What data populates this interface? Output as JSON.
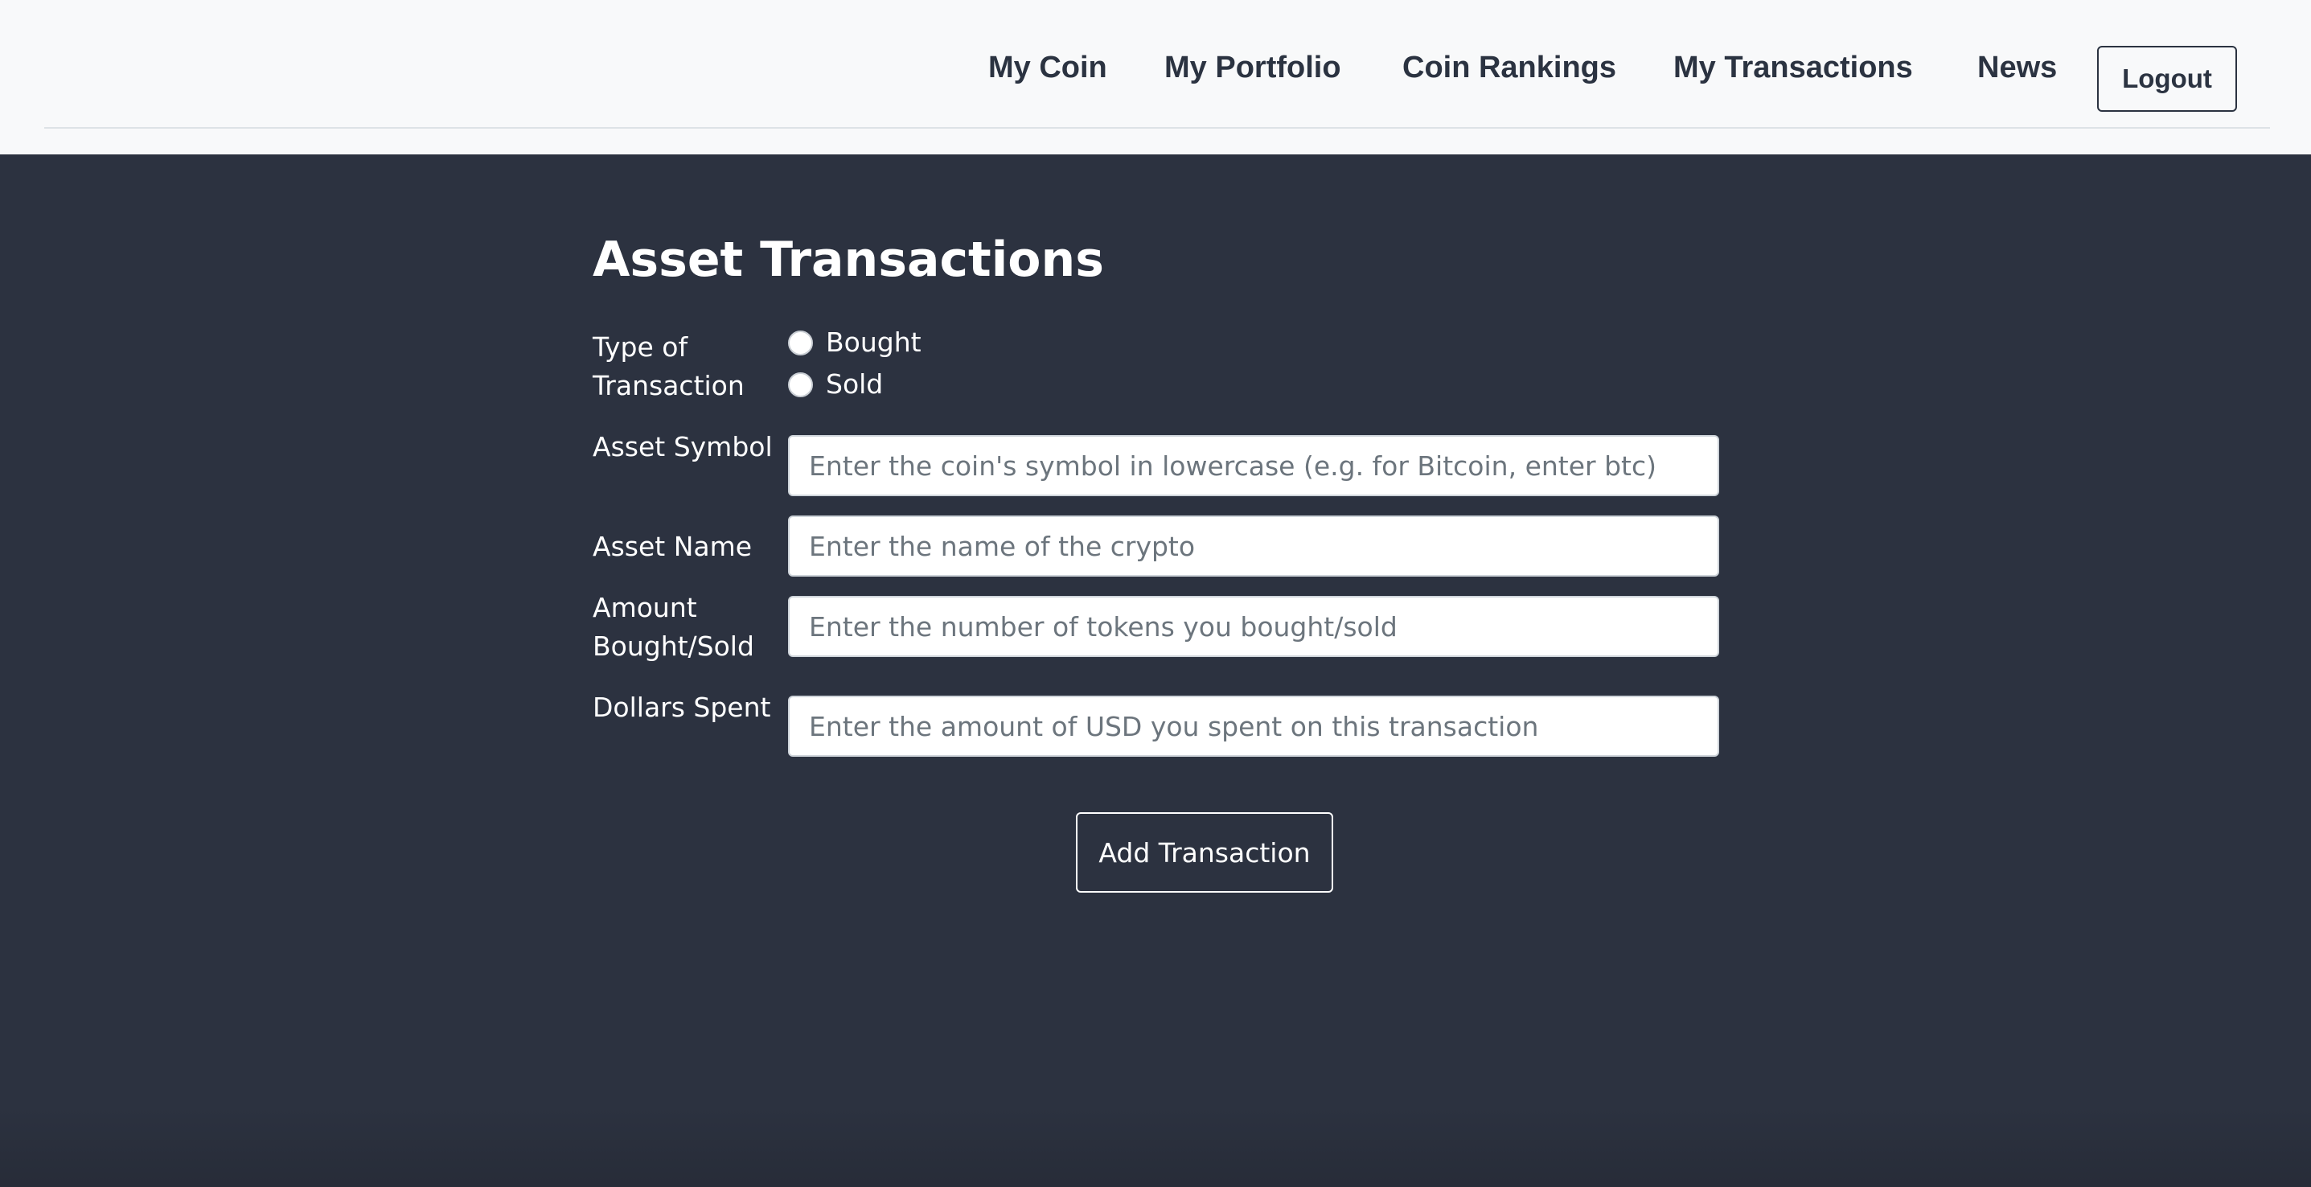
{
  "nav": {
    "links": [
      "My Coin",
      "My Portfolio",
      "Coin Rankings",
      "My Transactions",
      "News"
    ],
    "logout_label": "Logout"
  },
  "form": {
    "title": "Asset Transactions",
    "type_label": "Type of Transaction",
    "type_options": [
      "Bought",
      "Sold"
    ],
    "symbol_label": "Asset Symbol",
    "symbol_placeholder": "Enter the coin's symbol in lowercase (e.g. for Bitcoin, enter btc)",
    "symbol_value": "",
    "name_label": "Asset Name",
    "name_placeholder": "Enter the name of the crypto",
    "name_value": "",
    "amount_label": "Amount Bought/Sold",
    "amount_placeholder": "Enter the number of tokens you bought/sold",
    "amount_value": "",
    "dollars_label": "Dollars Spent",
    "dollars_placeholder": "Enter the amount of USD you spent on this transaction",
    "dollars_value": "",
    "submit_label": "Add Transaction"
  },
  "colors": {
    "navbar_bg": "#f8f9fa",
    "page_bg": "#2c3240",
    "nav_text": "#2b3341",
    "text_light": "#ffffff"
  }
}
